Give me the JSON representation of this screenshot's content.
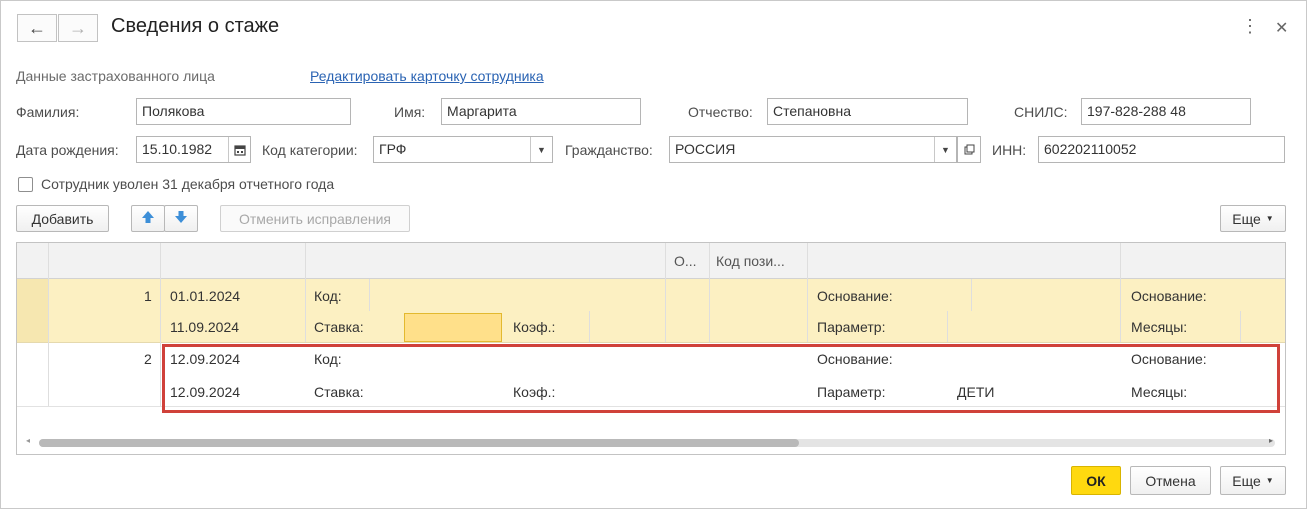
{
  "window": {
    "title": "Сведения о стаже"
  },
  "header": {
    "back_icon": "←",
    "forward_icon": "→",
    "more_icon": "⋮",
    "close_icon": "✕"
  },
  "person": {
    "section_label": "Данные застрахованного лица",
    "edit_link": "Редактировать карточку сотрудника",
    "surname_label": "Фамилия:",
    "surname": "Полякова",
    "name_label": "Имя:",
    "name": "Маргарита",
    "patronymic_label": "Отчество:",
    "patronymic": "Степановна",
    "snils_label": "СНИЛС:",
    "snils": "197-828-288 48",
    "birthdate_label": "Дата рождения:",
    "birthdate": "15.10.1982",
    "category_label": "Код категории:",
    "category": "ГРФ",
    "citizenship_label": "Гражданство:",
    "citizenship": "РОССИЯ",
    "inn_label": "ИНН:",
    "inn": "602202110052",
    "dismissed_label": "Сотрудник уволен 31 декабря отчетного года",
    "dismissed_checked": false
  },
  "toolbar": {
    "add_label": "Добавить",
    "undo_label": "Отменить исправления",
    "more_label": "Еще"
  },
  "table": {
    "columns": [
      "О...",
      "Код пози..."
    ],
    "rows": [
      {
        "num": "1",
        "date_from": "01.01.2024",
        "date_to": "11.09.2024",
        "code_label": "Код:",
        "rate_label": "Ставка:",
        "coef_label": "Коэф.:",
        "basis_label": "Основание:",
        "param_label": "Параметр:",
        "param_value": "",
        "basis2_label": "Основание:",
        "months_label": "Месяцы:"
      },
      {
        "num": "2",
        "date_from": "12.09.2024",
        "date_to": "12.09.2024",
        "code_label": "Код:",
        "rate_label": "Ставка:",
        "coef_label": "Коэф.:",
        "basis_label": "Основание:",
        "param_label": "Параметр:",
        "param_value": "ДЕТИ",
        "basis2_label": "Основание:",
        "months_label": "Месяцы:"
      }
    ]
  },
  "footer": {
    "ok_label": "ОК",
    "cancel_label": "Отмена",
    "more_label": "Еще"
  },
  "colors": {
    "selected_row": "#fcf0c2",
    "active_cell": "#ffe08a",
    "highlight_frame": "#d0413a",
    "ok_button": "#ffd90f",
    "link": "#2a63b3"
  }
}
